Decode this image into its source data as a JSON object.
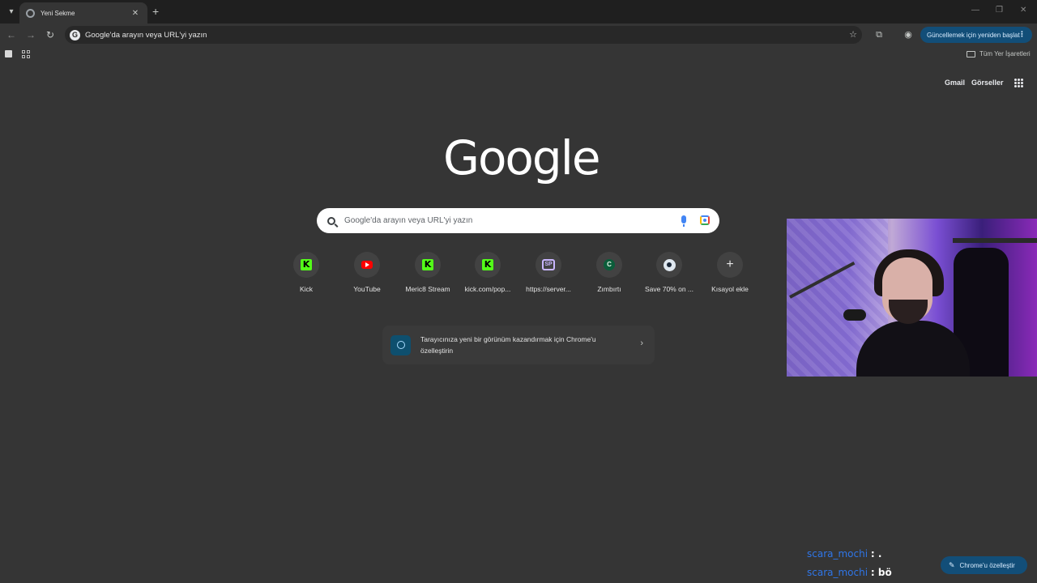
{
  "browser": {
    "tab": {
      "title": "Yeni Sekme"
    },
    "omnibox": {
      "text": "Google'da arayın veya URL'yi yazın"
    },
    "update_button": "Güncellemek için yeniden başlat",
    "bookmarks": {
      "all_bookmarks": "Tüm Yer İşaretleri"
    }
  },
  "header": {
    "gmail": "Gmail",
    "images": "Görseller"
  },
  "logo": "Google",
  "search": {
    "placeholder": "Google'da arayın veya URL'yi yazın"
  },
  "shortcuts": [
    {
      "label": "Kick",
      "icon": "kick-icon",
      "glyph": "K"
    },
    {
      "label": "YouTube",
      "icon": "youtube-icon",
      "glyph": ""
    },
    {
      "label": "Meric8 Stream",
      "icon": "kick-icon",
      "glyph": "K"
    },
    {
      "label": "kick.com/pop...",
      "icon": "kick-icon",
      "glyph": "K"
    },
    {
      "label": "https://server...",
      "icon": "server-icon",
      "glyph": "SP"
    },
    {
      "label": "Zımbırtı",
      "icon": "letter-c-icon",
      "glyph": "C"
    },
    {
      "label": "Save 70% on ...",
      "icon": "steam-icon",
      "glyph": ""
    },
    {
      "label": "Kısayol ekle",
      "icon": "plus-icon",
      "glyph": "+"
    }
  ],
  "customize_card": {
    "text": "Tarayıcınıza yeni bir görünüm kazandırmak için Chrome'u özelleştirin"
  },
  "chat": [
    {
      "user": "scara_mochi",
      "message": ": ."
    },
    {
      "user": "scara_mochi",
      "message": ": bö"
    }
  ],
  "customize_button": "Chrome'u özelleştir",
  "colors": {
    "background": "#353535",
    "accent": "#124e78",
    "kick": "#53fc18",
    "youtube": "#ff0000"
  }
}
